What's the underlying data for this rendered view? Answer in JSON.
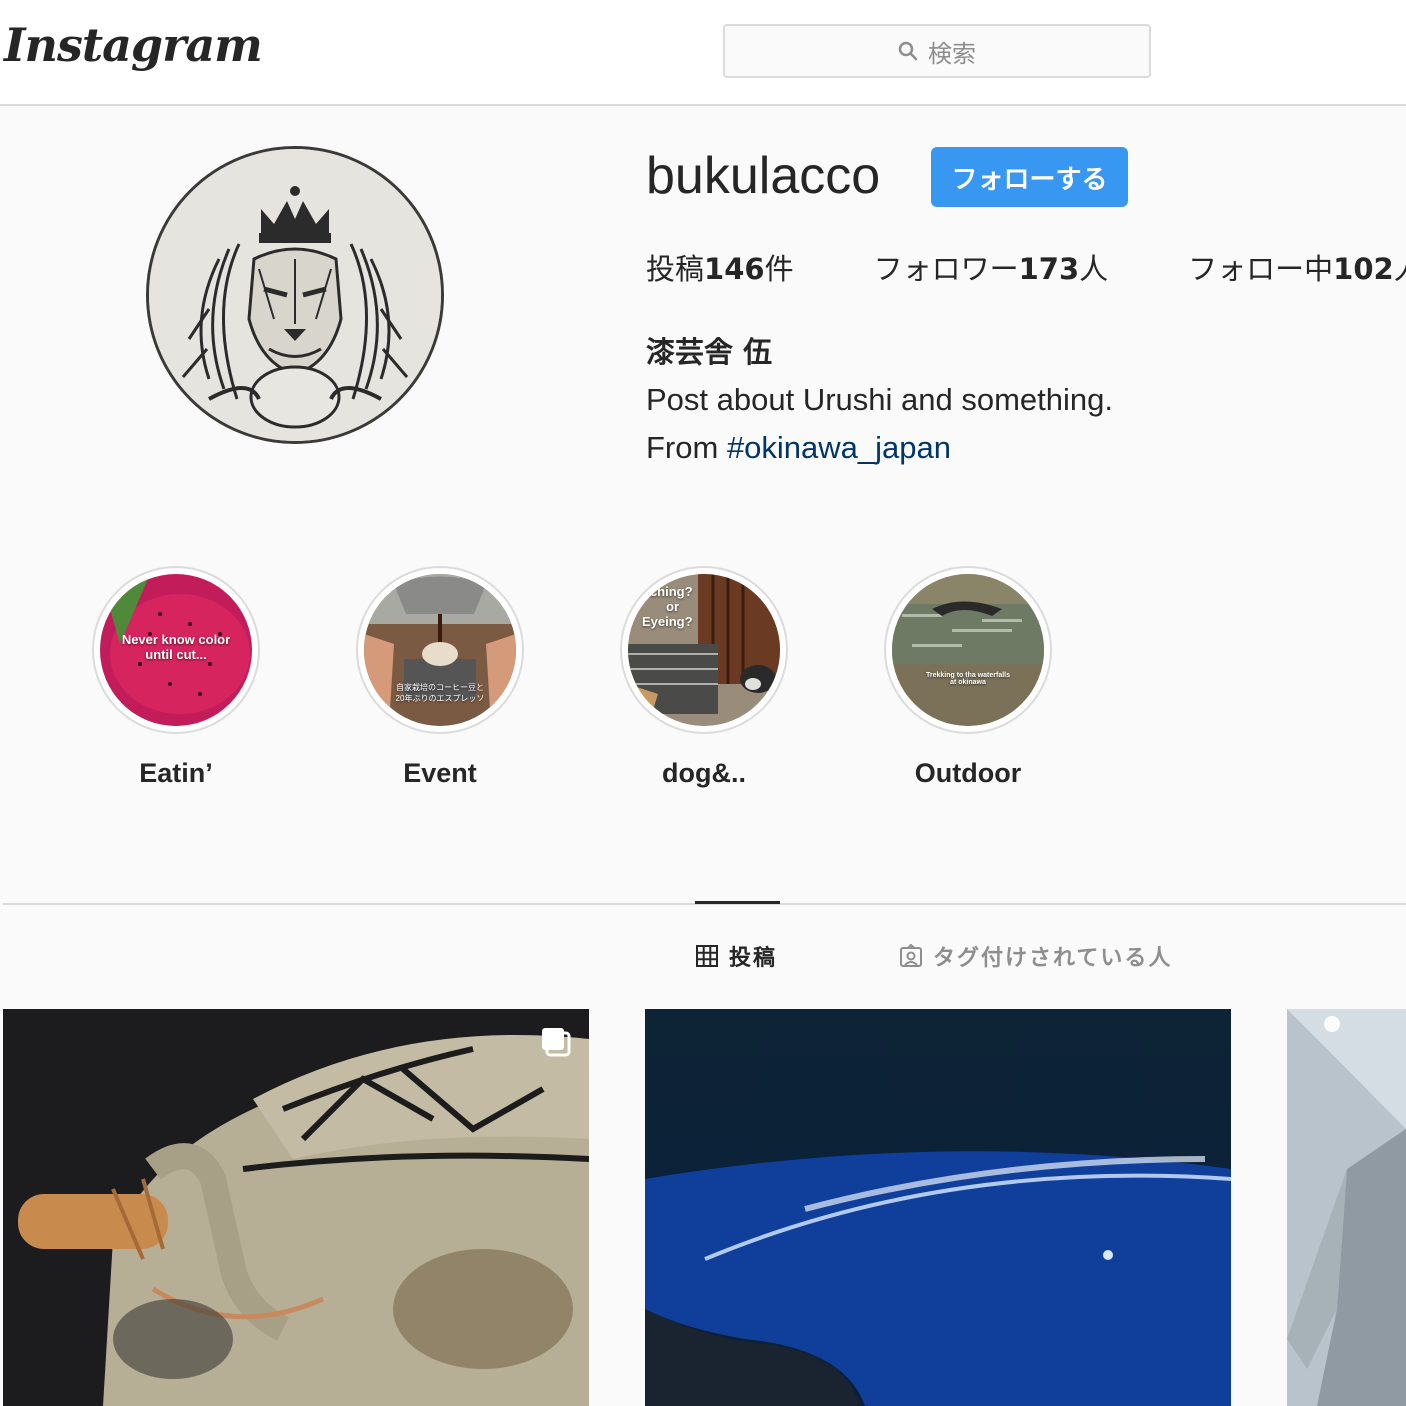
{
  "header": {
    "logo": "Instagram",
    "search_placeholder": "検索"
  },
  "profile": {
    "username": "bukulacco",
    "follow_label": "フォローする",
    "stats": {
      "posts_prefix": "投稿",
      "posts_count": "146",
      "posts_suffix": "件",
      "followers_prefix": "フォロワー",
      "followers_count": "173",
      "followers_suffix": "人",
      "following_prefix": "フォロー中",
      "following_count": "102",
      "following_suffix": "人"
    },
    "full_name": "漆芸舎 伍",
    "bio_line1": "Post about Urushi and something.",
    "bio_line2_prefix": "From ",
    "bio_hashtag": "#okinawa_japan"
  },
  "highlights": [
    {
      "label": "Eatin’",
      "caption1": "Never know color",
      "caption2": "until cut..."
    },
    {
      "label": "Event",
      "caption1": "自家栽培のコーヒー豆と",
      "caption2": "20年ぶりのエスプレッソ"
    },
    {
      "label": "dog&..",
      "caption1": "itching?",
      "caption2": "or",
      "caption3": "Eyeing?"
    },
    {
      "label": "Outdoor",
      "caption1": "Trekking to tha waterfalls",
      "caption2": "at okinawa"
    }
  ],
  "tabs": {
    "posts": "投稿",
    "tagged": "タグ付けされている人"
  },
  "colors": {
    "follow_button": "#3897f0",
    "hashtag": "#003569",
    "border": "#dbdbdb",
    "background": "#fafafa"
  }
}
